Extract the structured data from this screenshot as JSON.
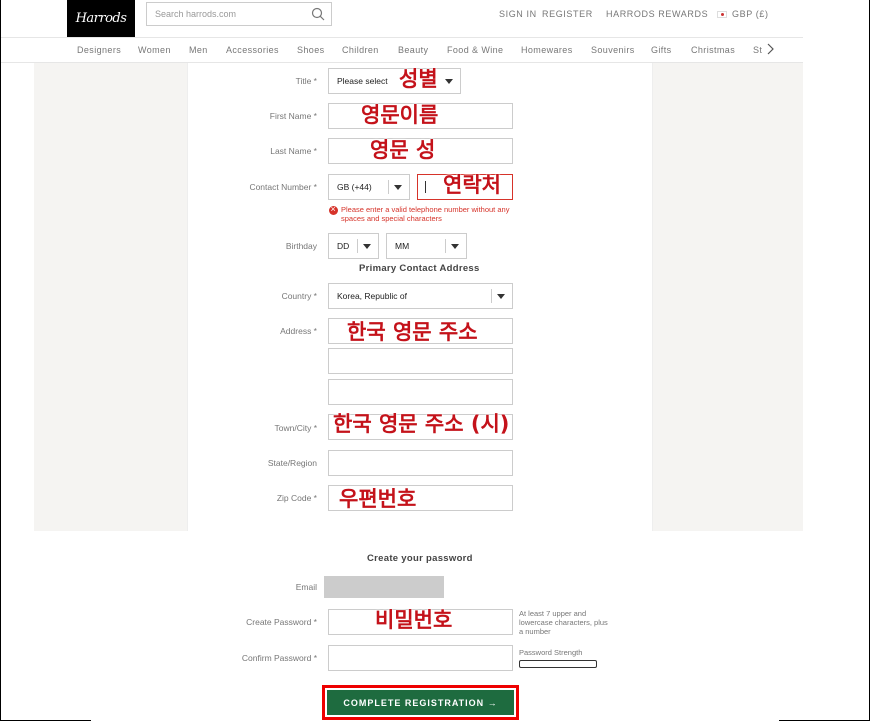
{
  "header": {
    "logo": "Harrods",
    "search_placeholder": "Search harrods.com",
    "sign_in": "SIGN IN",
    "register": "REGISTER",
    "rewards": "HARRODS REWARDS",
    "currency": "GBP (£)"
  },
  "nav": {
    "items": [
      "Designers",
      "Women",
      "Men",
      "Accessories",
      "Shoes",
      "Children",
      "Beauty",
      "Food & Wine",
      "Homewares",
      "Souvenirs",
      "Gifts",
      "Christmas",
      "St"
    ]
  },
  "form": {
    "title_label": "Title *",
    "title_value": "Please select",
    "first_name_label": "First Name *",
    "last_name_label": "Last Name *",
    "contact_label": "Contact Number *",
    "contact_code": "GB (+44)",
    "error_text": "Please enter a valid telephone number without any spaces and special characters",
    "birthday_label": "Birthday",
    "birthday_day": "DD",
    "birthday_month": "MM",
    "primary_address": "Primary Contact Address",
    "country_label": "Country *",
    "country_value": "Korea, Republic of",
    "address_label": "Address *",
    "town_label": "Town/City *",
    "state_label": "State/Region",
    "zip_label": "Zip Code *",
    "create_password_heading": "Create your password",
    "email_label": "Email",
    "create_password_label": "Create Password *",
    "password_hint": "At least 7 upper and lowercase characters, plus a number",
    "confirm_password_label": "Confirm Password *",
    "password_strength": "Password Strength",
    "submit": "COMPLETE REGISTRATION →"
  },
  "annotations": {
    "gender": "성별",
    "english_name": "영문이름",
    "english_surname": "영문 성",
    "contact": "연락처",
    "address": "한국 영문 주소",
    "city": "한국 영문 주소 (시)",
    "postcode": "우편번호",
    "password": "비밀번호"
  },
  "colors": {
    "accent_green": "#1e6b3f",
    "error_red": "#d6332a",
    "annotation_red": "#c4121a"
  }
}
